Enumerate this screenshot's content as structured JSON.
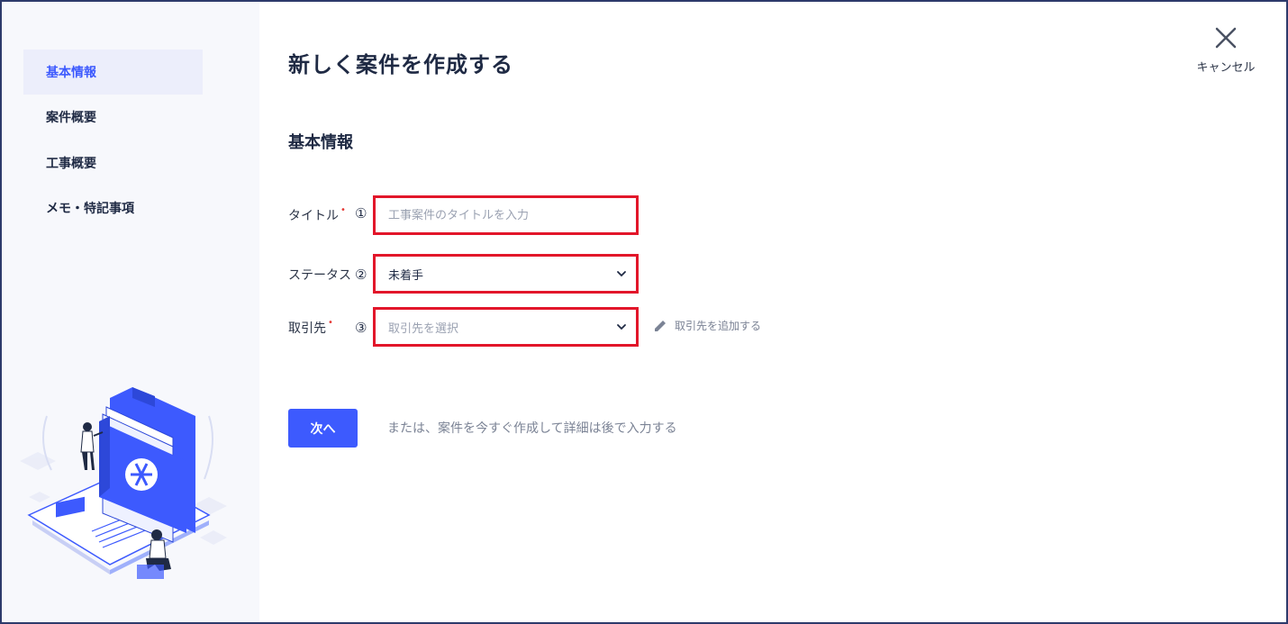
{
  "sidebar": {
    "items": [
      {
        "label": "基本情報",
        "active": true
      },
      {
        "label": "案件概要",
        "active": false
      },
      {
        "label": "工事概要",
        "active": false
      },
      {
        "label": "メモ・特記事項",
        "active": false
      }
    ]
  },
  "header": {
    "title": "新しく案件を作成する",
    "cancel_label": "キャンセル",
    "cancel_icon": "close-icon"
  },
  "section": {
    "title": "基本情報"
  },
  "form": {
    "title_field": {
      "label": "タイトル",
      "required": "•",
      "number": "①",
      "placeholder": "工事案件のタイトルを入力",
      "value": ""
    },
    "status_field": {
      "label": "ステータス",
      "number": "②",
      "value": "未着手"
    },
    "client_field": {
      "label": "取引先",
      "required": "•",
      "number": "③",
      "placeholder": "取引先を選択"
    },
    "add_client_label": "取引先を追加する",
    "next_label": "次へ",
    "alt_text": "または、案件を今すぐ作成して詳細は後で入力する"
  },
  "colors": {
    "accent": "#3d5afe",
    "highlight_border": "#e2162a",
    "required": "#e53935",
    "sidebar_bg": "#f7f8fc"
  }
}
